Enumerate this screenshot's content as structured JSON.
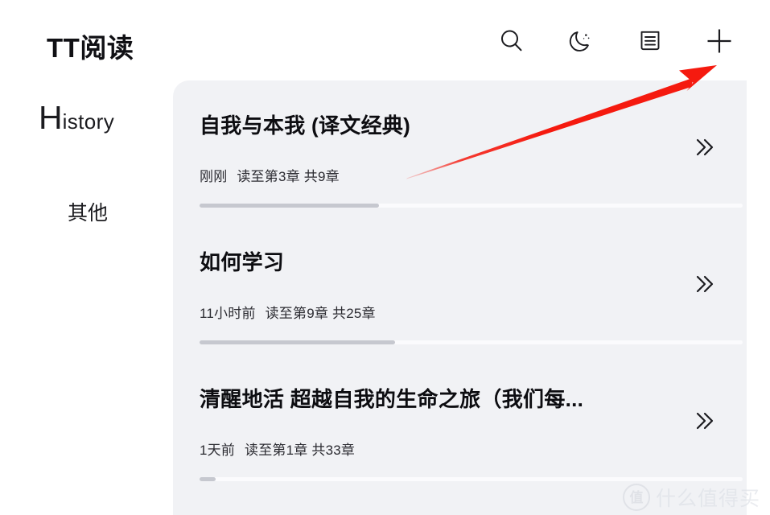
{
  "app": {
    "title": "TT阅读"
  },
  "header": {
    "actions": [
      {
        "name": "search-icon",
        "label": "搜索"
      },
      {
        "name": "night-mode-icon",
        "label": "夜间模式"
      },
      {
        "name": "document-list-icon",
        "label": "书籍列表"
      },
      {
        "name": "add-icon",
        "label": "添加"
      }
    ]
  },
  "sidebar": {
    "items": [
      {
        "label_cap": "H",
        "label_rest": "istory",
        "full": "History"
      },
      {
        "label": "其他"
      }
    ]
  },
  "books": [
    {
      "title": "自我与本我 (译文经典)",
      "time": "刚刚",
      "read_to": "读至第3章",
      "total": "共9章",
      "progress_percent": 33,
      "chevron": "double-chevron-right-icon"
    },
    {
      "title": "如何学习",
      "time": "11小时前",
      "read_to": "读至第9章",
      "total": "共25章",
      "progress_percent": 36,
      "chevron": "double-chevron-right-icon"
    },
    {
      "title": "清醒地活 超越自我的生命之旅（我们每...",
      "time": "1天前",
      "read_to": "读至第1章",
      "total": "共33章",
      "progress_percent": 3,
      "chevron": "double-chevron-right-icon"
    }
  ],
  "annotation": {
    "arrow_color": "#f51a0f",
    "points_to": "add-icon"
  },
  "watermark": {
    "badge": "值",
    "text": "什么值得买"
  },
  "colors": {
    "page_background": "#ffffff",
    "panel_background": "#f1f2f5",
    "text_primary": "#0d0d11",
    "text_secondary": "#2b2b31",
    "progress_fill": "#c6c8cf",
    "progress_track": "#fbfbfd"
  }
}
